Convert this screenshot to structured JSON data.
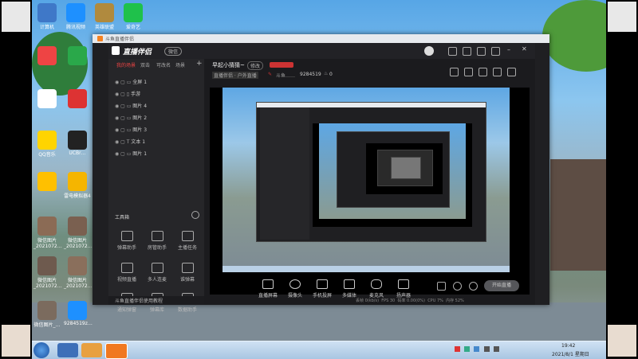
{
  "desktop": {
    "icons": [
      {
        "label": "计算机",
        "color": "#3f78c8"
      },
      {
        "label": "腾讯视频",
        "color": "#1e90ff"
      },
      {
        "label": "英雄联盟",
        "color": "#b08a3e"
      },
      {
        "label": "爱奇艺",
        "color": "#1fc14b"
      },
      {
        "label": "",
        "color": "#e44"
      },
      {
        "label": "",
        "color": "#2aa84a"
      },
      {
        "label": "",
        "color": "#ffffff"
      },
      {
        "label": "",
        "color": "#d33"
      },
      {
        "label": "QQ音乐",
        "color": "#ffd400"
      },
      {
        "label": "UCBr…",
        "color": "#222222"
      },
      {
        "label": "",
        "color": "#ffc000"
      },
      {
        "label": "雷电模拟器4",
        "color": "#f5b500"
      },
      {
        "label": "微信图片_2021072…",
        "color": "#8b6b55"
      },
      {
        "label": "微信图片_2021072…",
        "color": "#7a6050"
      },
      {
        "label": "微信图片_2021072…",
        "color": "#6e5a4e"
      },
      {
        "label": "微信图片_2021072…",
        "color": "#8a6f5c"
      },
      {
        "label": "微信图片_…",
        "color": "#7b6b5e"
      },
      {
        "label": "9284519z…",
        "color": "#1e90ff"
      }
    ]
  },
  "taskbar": {
    "time": "19:42",
    "date": "2021/8/1 星期日"
  },
  "window": {
    "outer_title": "斗鱼直播伴侣",
    "logo": "直播伴侣",
    "logo_badge": "微信",
    "room_title": "早起小猜猜~",
    "edit_btn": "修改",
    "live_tag": "",
    "category": "直播伴侣 · 户外直播",
    "streamer": "斗鱼……",
    "room_id": "9284519",
    "hot": "0"
  },
  "sidebar": {
    "tabs": [
      "我的场景",
      "双击",
      "可改名",
      "场景"
    ],
    "sources": [
      "全屏 1",
      "手游",
      "图片 4",
      "图片 2",
      "图片 3",
      "文本 1",
      "图片 1"
    ],
    "tools_title": "工具箱",
    "tools": [
      "弹幕助手",
      "房管助手",
      "主播任务",
      "视频直播",
      "多人连麦",
      "谁弹幕",
      "通知弹窗",
      "弹幕库",
      "数据助手",
      "",
      ""
    ],
    "footer": "斗鱼直播伴侣使用教程"
  },
  "controls": {
    "buttons": [
      "直播屏幕",
      "摄像头",
      "手机投屏",
      "多媒体",
      "麦克风",
      "扬声器"
    ],
    "start_label": "开始直播",
    "status": [
      "丢帧 0(kb/s)",
      "FPS 30",
      "码率 0.00(0%)",
      "CPU 7%",
      "内存 52%"
    ]
  }
}
